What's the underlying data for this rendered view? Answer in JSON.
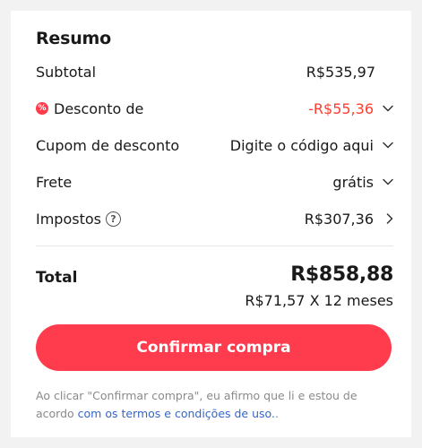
{
  "summary": {
    "title": "Resumo",
    "subtotal_label": "Subtotal",
    "subtotal_value": "R$535,97",
    "discount_label": "Desconto de",
    "discount_value": "-R$55,36",
    "coupon_label": "Cupom de desconto",
    "coupon_action": "Digite o código aqui",
    "shipping_label": "Frete",
    "shipping_value": "grátis",
    "taxes_label": "Impostos",
    "taxes_help": "?",
    "taxes_value": "R$307,36",
    "total_label": "Total",
    "total_value": "R$858,88",
    "installments": "R$71,57 X 12 meses",
    "confirm_label": "Confirmar compra",
    "legal_text": "Ao clicar \"Confirmar compra\", eu afirmo que li e estou de acordo ",
    "legal_link": "com os termos e condições de uso.",
    "legal_end": "."
  },
  "icons": {
    "discount": "percent-badge-icon",
    "expand": "chevron-down-icon",
    "navigate": "chevron-right-icon",
    "help": "help-circle-icon"
  },
  "colors": {
    "accent": "#ff3b4e",
    "discount": "#ff3c2e",
    "link": "#3466c9"
  }
}
